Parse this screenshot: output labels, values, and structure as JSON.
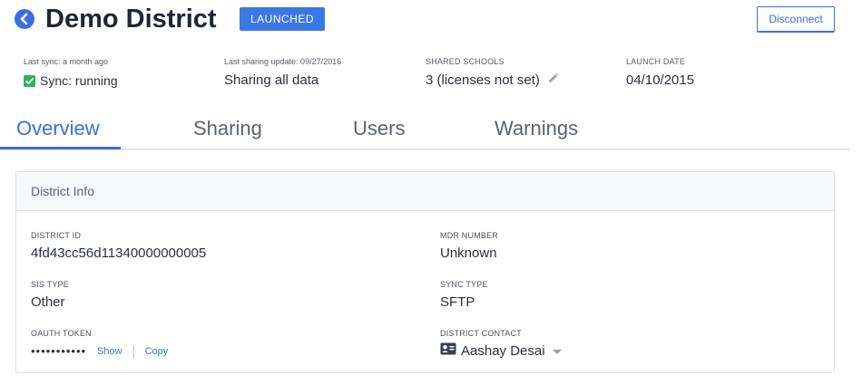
{
  "header": {
    "title": "Demo District",
    "status": "LAUNCHED",
    "disconnect_label": "Disconnect"
  },
  "meta": {
    "last_sync_label": "Last sync: a month ago",
    "sync_status": "Sync: running",
    "last_sharing_label": "Last sharing update: 09/27/2016",
    "sharing_value": "Sharing all data",
    "shared_schools_label": "SHARED SCHOOLS",
    "shared_schools_value": "3 (licenses not set)",
    "launch_date_label": "LAUNCH DATE",
    "launch_date_value": "04/10/2015"
  },
  "tabs": [
    {
      "label": "Overview",
      "active": true
    },
    {
      "label": "Sharing",
      "active": false
    },
    {
      "label": "Users",
      "active": false
    },
    {
      "label": "Warnings",
      "active": false
    }
  ],
  "card": {
    "title": "District Info",
    "district_id_label": "DISTRICT ID",
    "district_id_value": "4fd43cc56d11340000000005",
    "mdr_label": "MDR NUMBER",
    "mdr_value": "Unknown",
    "sis_type_label": "SIS TYPE",
    "sis_type_value": "Other",
    "sync_type_label": "SYNC TYPE",
    "sync_type_value": "SFTP",
    "oauth_label": "OAUTH TOKEN",
    "oauth_masked": "•••••••••••",
    "show_label": "Show",
    "copy_label": "Copy",
    "contact_label": "DISTRICT CONTACT",
    "contact_value": "Aashay Desai"
  },
  "colors": {
    "accent": "#3b6fe0",
    "badge": "#3b78e7",
    "success": "#28b463"
  },
  "icons": {
    "back": "chevron-left-circle-icon",
    "check": "checkbox-checked-icon",
    "edit": "pencil-icon",
    "contact": "contact-card-icon",
    "dropdown": "caret-down-icon"
  }
}
